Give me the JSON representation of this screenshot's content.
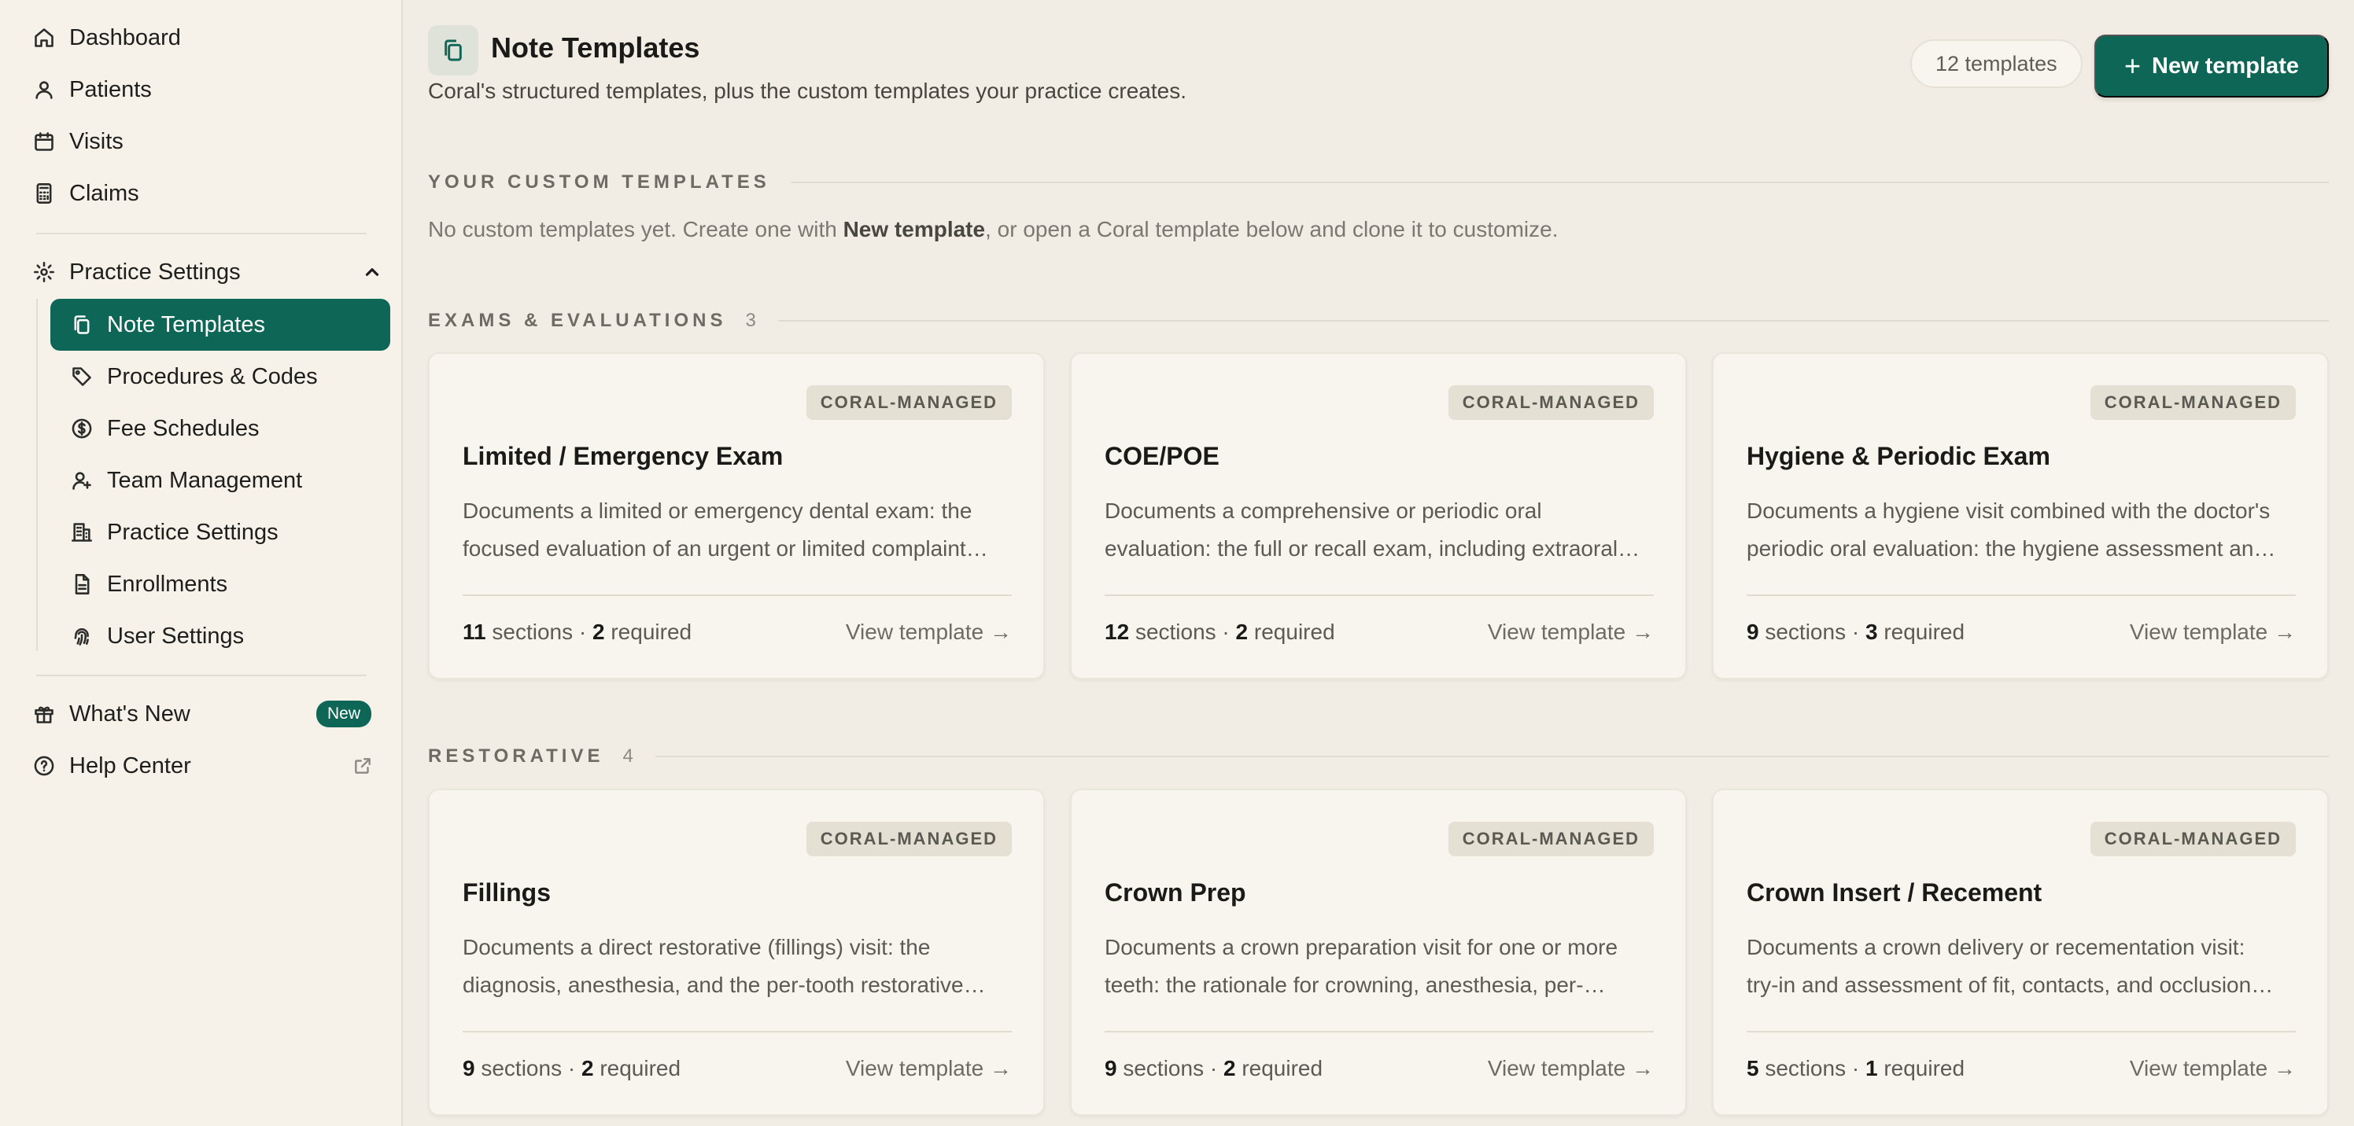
{
  "sidebar": {
    "nav": [
      {
        "label": "Dashboard",
        "icon": "home-icon"
      },
      {
        "label": "Patients",
        "icon": "user-icon"
      },
      {
        "label": "Visits",
        "icon": "calendar-icon"
      },
      {
        "label": "Claims",
        "icon": "calculator-icon"
      }
    ],
    "practice_settings": {
      "label": "Practice Settings",
      "icon": "gear-icon",
      "expanded": true
    },
    "sub_items": [
      {
        "label": "Note Templates",
        "icon": "copy-icon",
        "active": true
      },
      {
        "label": "Procedures & Codes",
        "icon": "tag-icon"
      },
      {
        "label": "Fee Schedules",
        "icon": "dollar-icon"
      },
      {
        "label": "Team Management",
        "icon": "user-plus-icon"
      },
      {
        "label": "Practice Settings",
        "icon": "building-icon"
      },
      {
        "label": "Enrollments",
        "icon": "document-icon"
      },
      {
        "label": "User Settings",
        "icon": "fingerprint-icon"
      }
    ],
    "whats_new": {
      "label": "What's New",
      "badge": "New",
      "icon": "gift-icon"
    },
    "help_center": {
      "label": "Help Center",
      "icon": "help-icon"
    }
  },
  "header": {
    "title": "Note Templates",
    "subtitle": "Coral's structured templates, plus the custom templates your practice creates.",
    "count": "12 templates",
    "new_button": "New template"
  },
  "custom_section": {
    "label": "YOUR CUSTOM TEMPLATES",
    "empty_prefix": "No custom templates yet. Create one with ",
    "empty_bold": "New template",
    "empty_suffix": ", or open a Coral template below and clone it to customize."
  },
  "sections": [
    {
      "label": "EXAMS & EVALUATIONS",
      "count": "3",
      "cards": [
        {
          "badge": "CORAL-MANAGED",
          "title": "Limited / Emergency Exam",
          "desc1": "Documents a limited or emergency dental exam: the",
          "desc2": "focused evaluation of an urgent or limited complaint…",
          "sections": "11",
          "sections_label": "sections",
          "required": "2",
          "required_label": "required",
          "link": "View template →"
        },
        {
          "badge": "CORAL-MANAGED",
          "title": "COE/POE",
          "desc1": "Documents a comprehensive or periodic oral",
          "desc2": "evaluation: the full or recall exam, including extraoral…",
          "sections": "12",
          "sections_label": "sections",
          "required": "2",
          "required_label": "required",
          "link": "View template →"
        },
        {
          "badge": "CORAL-MANAGED",
          "title": "Hygiene & Periodic Exam",
          "desc1": "Documents a hygiene visit combined with the doctor's",
          "desc2": "periodic oral evaluation: the hygiene assessment an…",
          "sections": "9",
          "sections_label": "sections",
          "required": "3",
          "required_label": "required",
          "link": "View template →"
        }
      ]
    },
    {
      "label": "RESTORATIVE",
      "count": "4",
      "cards": [
        {
          "badge": "CORAL-MANAGED",
          "title": "Fillings",
          "desc1": "Documents a direct restorative (fillings) visit: the",
          "desc2": "diagnosis, anesthesia, and the per-tooth restorative…",
          "sections": "9",
          "sections_label": "sections",
          "required": "2",
          "required_label": "required",
          "link": "View template →"
        },
        {
          "badge": "CORAL-MANAGED",
          "title": "Crown Prep",
          "desc1": "Documents a crown preparation visit for one or more",
          "desc2": "teeth: the rationale for crowning, anesthesia, per-…",
          "sections": "9",
          "sections_label": "sections",
          "required": "2",
          "required_label": "required",
          "link": "View template →"
        },
        {
          "badge": "CORAL-MANAGED",
          "title": "Crown Insert / Recement",
          "desc1": "Documents a crown delivery or recementation visit:",
          "desc2": "try-in and assessment of fit, contacts, and occlusion…",
          "sections": "5",
          "sections_label": "sections",
          "required": "1",
          "required_label": "required",
          "link": "View template →"
        }
      ]
    }
  ],
  "colors": {
    "accent": "#0e6656",
    "background": "#f1ede4",
    "sidebar": "#f6f2ea",
    "card": "#f8f5ee"
  }
}
